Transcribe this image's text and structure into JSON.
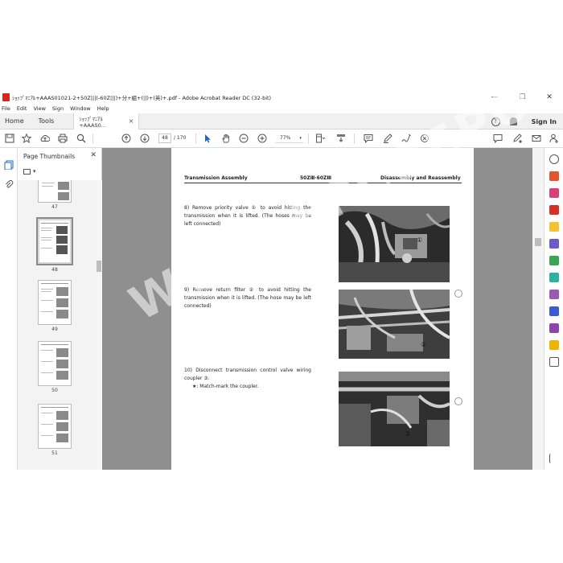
{
  "window": {
    "title": "ｼｮｯﾌﾟﾏﾆｱﾙ+AAAS01021-2+50Z|||(-60Z|||)+分+組+(||)+(英)+.pdf - Adobe Acrobat Reader DC (32-bit)",
    "minimize": "—",
    "maximize": "☐",
    "close": "✕"
  },
  "menu": [
    "File",
    "Edit",
    "View",
    "Sign",
    "Window",
    "Help"
  ],
  "tabs": {
    "home": "Home",
    "tools": "Tools",
    "document": "ｼｮｯﾌﾟﾏﾆｱﾙ+AAAS0...",
    "close": "×",
    "help": "?",
    "sign_in": "Sign In"
  },
  "toolbar": {
    "page_current": "48",
    "page_total": "/ 170",
    "zoom": "77%",
    "zoom_caret": "▾"
  },
  "thumbnails": {
    "title": "Page Thumbnails",
    "close": "✕",
    "options_caret": "▾",
    "pages": [
      "47",
      "48",
      "49",
      "50",
      "51"
    ],
    "selected": "48"
  },
  "document": {
    "header_left": "Transmission Assembly",
    "header_center": "50ZⅢ·60ZⅢ",
    "header_right": "Disassembly and Reassembly",
    "steps": [
      {
        "text": "8) Remove priority valve ① to avoid hitting the transmission when it is lifted. (The hoses may be left connected)",
        "callout": "①"
      },
      {
        "text": "9) Remove return filter ② to avoid hitting the transmission when it is lifted. (The hose may be left connected)",
        "callout": "②"
      },
      {
        "text": "10) Disconnect transmission control valve wiring coupler ③.",
        "note": "★: Match-mark the coupler.",
        "callout": "③"
      }
    ]
  },
  "watermark": "WWW.EPCDEPO.COM"
}
